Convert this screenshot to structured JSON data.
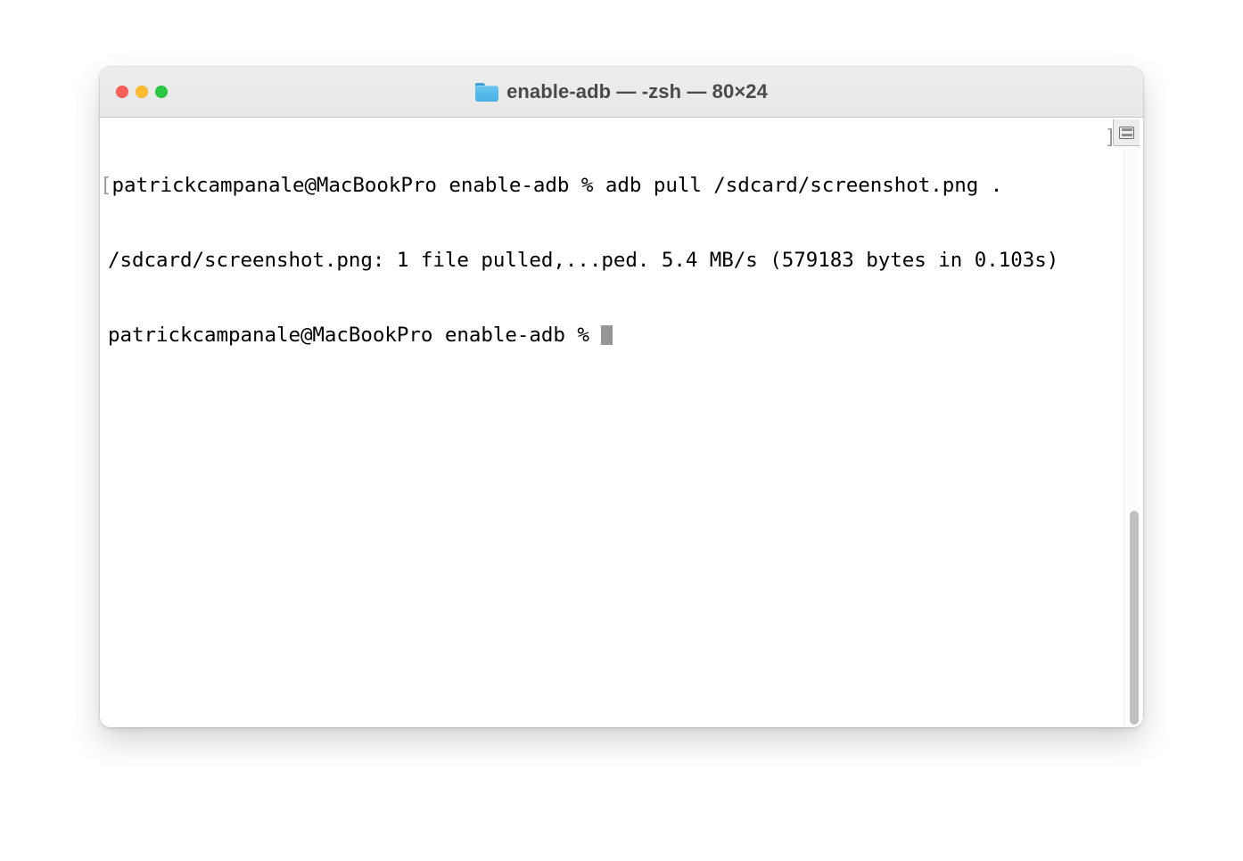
{
  "window": {
    "title": "enable-adb — -zsh — 80×24",
    "folder_icon": "folder-icon",
    "traffic_lights": [
      {
        "name": "close-button",
        "label": "Close",
        "color": "#FF5F57"
      },
      {
        "name": "minimize-button",
        "label": "Minimize",
        "color": "#FEBC2E"
      },
      {
        "name": "zoom-button",
        "label": "Zoom",
        "color": "#28C840"
      }
    ]
  },
  "terminal": {
    "shell": "-zsh",
    "size": "80×24",
    "profile_colors": {
      "background": "#FFFFFF",
      "foreground": "#000000",
      "cursor": "#969696",
      "bracket": "#9A9A9A"
    },
    "lines": [
      {
        "name": "prompt-command-line",
        "leading_bracket": "[",
        "text": "patrickcampanale@MacBookPro enable-adb % adb pull /sdcard/screenshot.png ."
      },
      {
        "name": "output-line",
        "leading_bracket": "",
        "text": "/sdcard/screenshot.png: 1 file pulled,...ped. 5.4 MB/s (579183 bytes in 0.103s)"
      },
      {
        "name": "active-prompt-line",
        "leading_bracket": "",
        "text": "patrickcampanale@MacBookPro enable-adb % "
      }
    ],
    "line_end_bracket": "]",
    "cursor": "block"
  },
  "controls": {
    "marks_button": "marks-button",
    "scrollbar": "vertical-scrollbar"
  }
}
